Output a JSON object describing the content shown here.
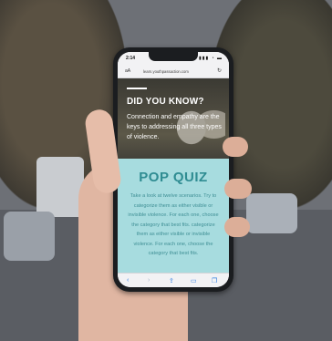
{
  "status_bar": {
    "time": "2:14",
    "icons": "▮▮▮ ◔ ▬"
  },
  "address_bar": {
    "aa_label": "aA",
    "url": "learn.youthpassaction.com",
    "reload_glyph": "↻"
  },
  "hero": {
    "title": "DID YOU KNOW?",
    "text": "Connection and empathy are the keys to addressing all three types of violence."
  },
  "quiz": {
    "title": "POP QUIZ",
    "text": "Take a look at twelve scenarios. Try to categorize them as either visible or invisible violence. For each one, choose the category that best fits. categorize them as either visible or invisible violence. For each one, choose the category that best fits."
  },
  "toolbar": {
    "back_glyph": "‹",
    "forward_glyph": "›",
    "share_glyph": "⇪",
    "bookmarks_glyph": "▭",
    "tabs_glyph": "❐"
  },
  "icons": [
    "back-icon",
    "forward-icon",
    "share-icon",
    "bookmarks-icon",
    "tabs-icon",
    "reload-icon"
  ],
  "colors": {
    "quiz_bg": "#a7dcdf",
    "quiz_accent": "#2f8c92",
    "link_blue": "#2d7de0"
  }
}
